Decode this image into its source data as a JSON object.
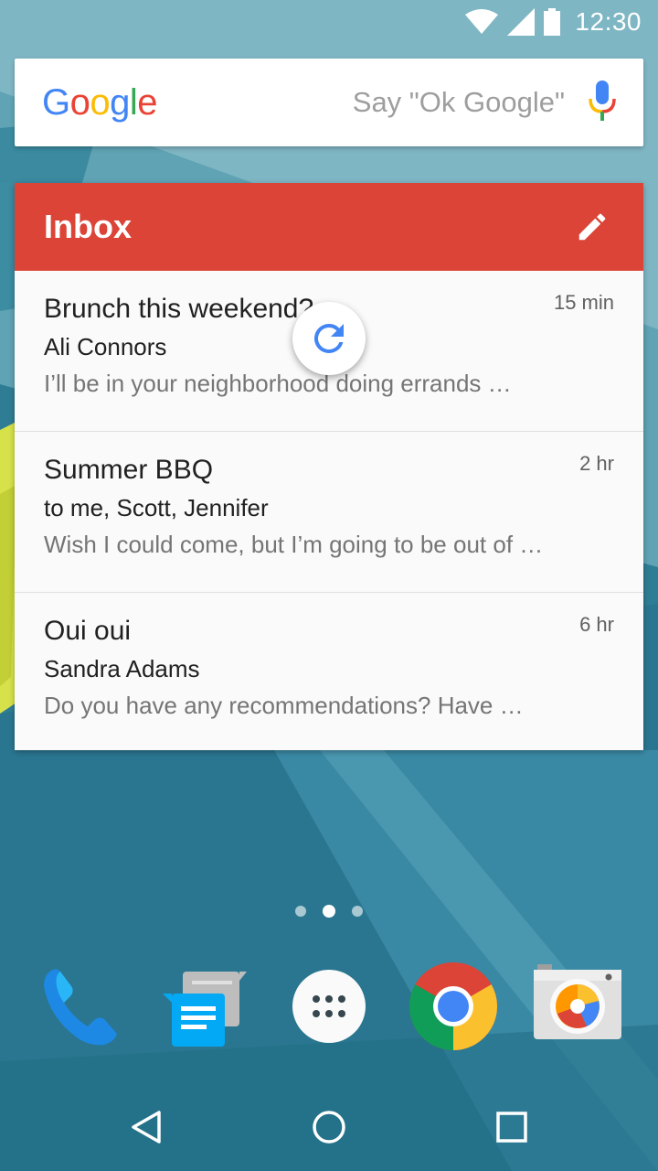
{
  "status_bar": {
    "time": "12:30",
    "icons": [
      "wifi-icon",
      "cell-signal-icon",
      "battery-icon"
    ]
  },
  "search": {
    "logo": [
      "G",
      "o",
      "o",
      "g",
      "l",
      "e"
    ],
    "logo_colors": [
      "#4285f4",
      "#ea4335",
      "#fbbc05",
      "#4285f4",
      "#34a853",
      "#ea4335"
    ],
    "hint": "Say \"Ok Google\"",
    "icon": "mic-icon"
  },
  "inbox": {
    "title": "Inbox",
    "accent": "#db4437",
    "action_icon": "edit-pencil-icon",
    "messages": [
      {
        "subject": "Brunch this weekend?",
        "from": "Ali Connors",
        "snippet": "I’ll be in your neighborhood doing errands …",
        "time": "15 min"
      },
      {
        "subject": "Summer BBQ",
        "from": "to me, Scott, Jennifer",
        "snippet": "Wish I could come, but I’m going to be out of …",
        "time": "2 hr"
      },
      {
        "subject": "Oui oui",
        "from": "Sandra Adams",
        "snippet": "Do you have any recommendations? Have …",
        "time": "6 hr"
      }
    ],
    "refresh_icon": "refresh-icon"
  },
  "page_indicator": {
    "pages": 3,
    "current": 2
  },
  "dock": {
    "apps": [
      "phone-icon",
      "messages-icon",
      "app-drawer-icon",
      "chrome-icon",
      "camera-icon"
    ]
  },
  "nav": {
    "buttons": [
      "back-icon",
      "home-icon",
      "recents-icon"
    ]
  }
}
